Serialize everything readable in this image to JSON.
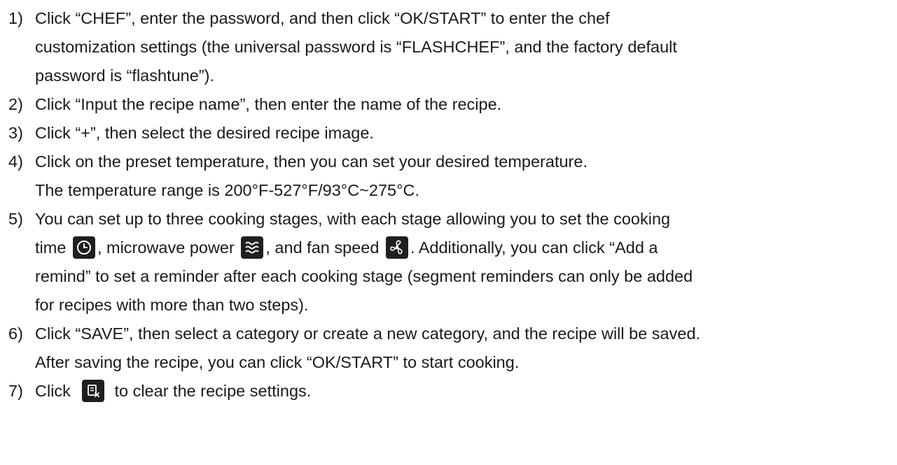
{
  "steps": [
    {
      "num": "1)",
      "lines": [
        "Click “CHEF”, enter the password, and then click “OK/START” to enter the chef",
        "customization settings (the universal password is “FLASHCHEF”, and the factory default",
        "password is “flashtune”)."
      ]
    },
    {
      "num": "2)",
      "lines": [
        "Click “Input the recipe name”, then enter the name of the recipe."
      ]
    },
    {
      "num": "3)",
      "lines": [
        "Click “+”, then select the desired recipe image."
      ]
    },
    {
      "num": "4)",
      "lines": [
        "Click on the preset temperature, then you can set your desired temperature.",
        "The temperature range is 200°F-527°F/93°C~275°C."
      ]
    },
    {
      "num": "5)",
      "line1": "You can set up to three cooking stages, with each stage allowing you to set the cooking",
      "line2_a": "time",
      "line2_b": ", microwave power",
      "line2_c": ", and fan speed",
      "line2_d": ". Additionally, you can click “Add a",
      "line3": "remind” to set a reminder after each cooking stage (segment reminders can only be added",
      "line4": "for recipes with more than two steps)."
    },
    {
      "num": "6)",
      "lines": [
        "Click “SAVE”, then select a category or create a new category, and the recipe will be saved.",
        "After saving the recipe, you can click “OK/START” to start cooking."
      ]
    },
    {
      "num": "7)",
      "line_a": "Click",
      "line_b": "to clear the recipe settings."
    }
  ],
  "icons": {
    "time": "clock-icon",
    "power": "microwave-power-icon",
    "fan": "fan-speed-icon",
    "clear": "clear-settings-icon"
  }
}
